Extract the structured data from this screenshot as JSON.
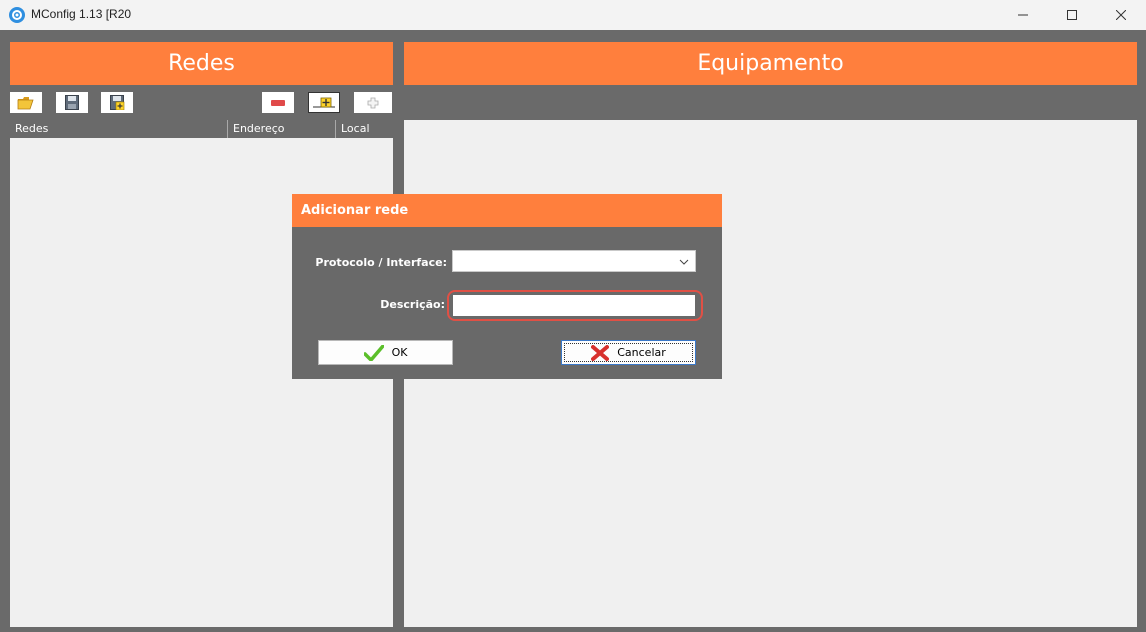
{
  "window": {
    "title": "MConfig 1.13 [R20",
    "controls": {
      "minimize": "minimize",
      "maximize": "maximize",
      "close": "close"
    }
  },
  "left_panel": {
    "title": "Redes",
    "toolbar": [
      "open-folder-icon",
      "save-icon",
      "save-add-icon",
      "remove-icon",
      "add-device-icon",
      "add-icon"
    ],
    "columns": [
      "Redes",
      "Endereço",
      "Local"
    ]
  },
  "right_panel": {
    "title": "Equipamento"
  },
  "dialog": {
    "title": "Adicionar rede",
    "protocol_label": "Protocolo / Interface:",
    "protocol_value": "",
    "description_label": "Descrição:",
    "description_value": "",
    "ok_label": "OK",
    "cancel_label": "Cancelar"
  },
  "colors": {
    "accent": "#ff7f3d",
    "background": "#6a6a6a",
    "panel": "#f0f0f0",
    "focus_ring": "#e05045"
  }
}
